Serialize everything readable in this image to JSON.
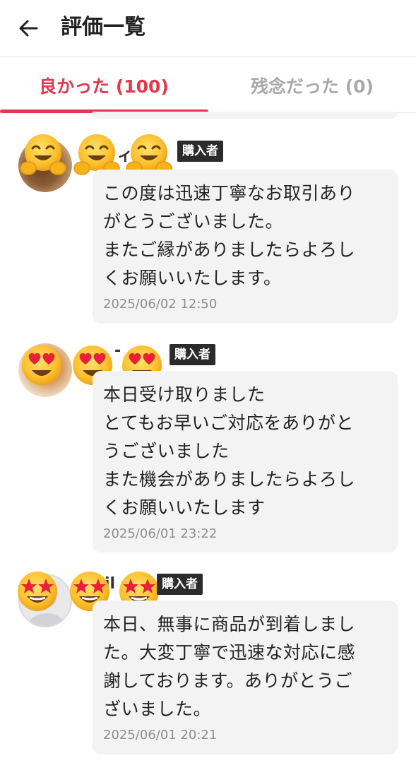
{
  "header": {
    "title": "評価一覧",
    "back_icon": "arrow-left-icon"
  },
  "tabs": [
    {
      "label": "良かった (100)",
      "active": true
    },
    {
      "label": "残念だった (0)",
      "active": false
    }
  ],
  "colors": {
    "accent": "#e0384e",
    "inactive_tab": "#a9a9a9",
    "bubble_bg": "#f3f3f3",
    "badge_bg": "#2b2b2b"
  },
  "reviews": [
    {
      "name_fragment": "ィ",
      "badge": "購入者",
      "emoji": "hugging-face-emoji",
      "comment": "この度は迅速丁寧なお取引あり\nがとうございました。\nまたご縁がありましたらよろし\nくお願いいたします。",
      "datetime": "2025/06/02 12:50"
    },
    {
      "name_fragment": "-",
      "badge": "購入者",
      "emoji": "heart-eyes-emoji",
      "comment": "本日受け取りました\nとてもお早いご対応をありがと\nうございました\nまた機会がありましたらよろし\nくお願いいたします",
      "datetime": "2025/06/01 23:22"
    },
    {
      "name_fragment": "il",
      "badge": "購入者",
      "emoji": "star-struck-emoji",
      "comment": "本日、無事に商品が到着しまし\nた。大変丁寧で迅速な対応に感\n謝しております。ありがとうご\nざいました。",
      "datetime": "2025/06/01 20:21"
    }
  ]
}
